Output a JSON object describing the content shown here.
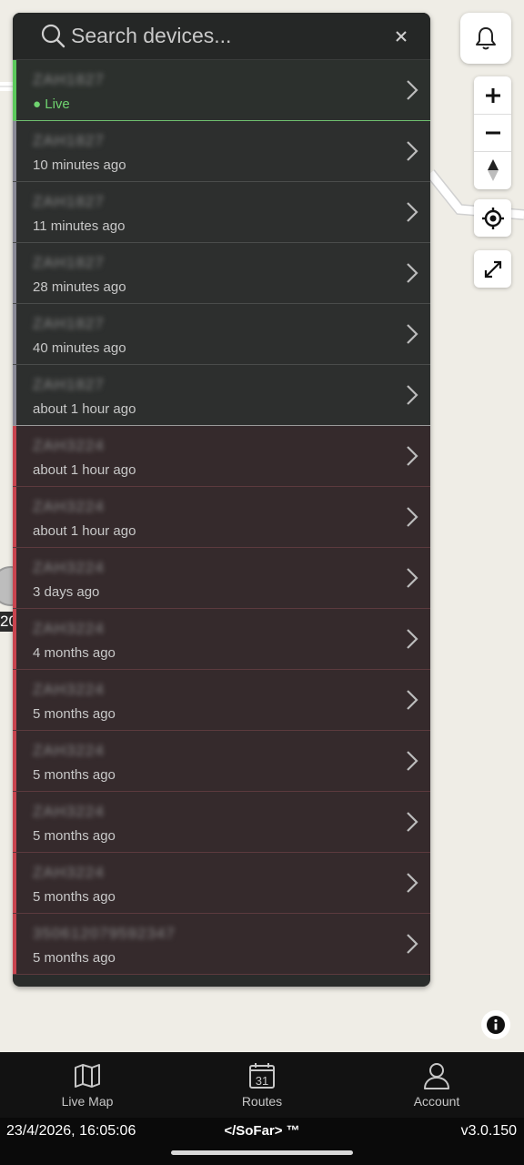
{
  "search": {
    "placeholder": "Search devices..."
  },
  "devices": [
    {
      "name": "ZAH1827",
      "status": "Live",
      "group": "online"
    },
    {
      "name": "ZAH1827",
      "status": "10 minutes ago",
      "group": "recent"
    },
    {
      "name": "ZAH1827",
      "status": "11 minutes ago",
      "group": "recent"
    },
    {
      "name": "ZAH1827",
      "status": "28 minutes ago",
      "group": "recent"
    },
    {
      "name": "ZAH1827",
      "status": "40 minutes ago",
      "group": "recent"
    },
    {
      "name": "ZAH1827",
      "status": "about 1 hour ago",
      "group": "recent"
    },
    {
      "name": "ZAH3224",
      "status": "about 1 hour ago",
      "group": "stale"
    },
    {
      "name": "ZAH3224",
      "status": "about 1 hour ago",
      "group": "stale"
    },
    {
      "name": "ZAH3224",
      "status": "3 days ago",
      "group": "stale"
    },
    {
      "name": "ZAH3224",
      "status": "4 months ago",
      "group": "stale"
    },
    {
      "name": "ZAH3224",
      "status": "5 months ago",
      "group": "stale"
    },
    {
      "name": "ZAH3224",
      "status": "5 months ago",
      "group": "stale"
    },
    {
      "name": "ZAH3224",
      "status": "5 months ago",
      "group": "stale"
    },
    {
      "name": "ZAH3224",
      "status": "5 months ago",
      "group": "stale"
    },
    {
      "name": "350612079592347",
      "status": "5 months ago",
      "group": "stale"
    }
  ],
  "map": {
    "marker_label": "20"
  },
  "nav": {
    "live_map": "Live Map",
    "routes": "Routes",
    "routes_day": "31",
    "account": "Account"
  },
  "footer": {
    "timestamp": "23/4/2026, 16:05:06",
    "brand": "</SoFar> ™",
    "version": "v3.0.150"
  },
  "colors": {
    "online": "#5cc95c",
    "recent": "#8a8a96",
    "stale": "#c8444f"
  }
}
